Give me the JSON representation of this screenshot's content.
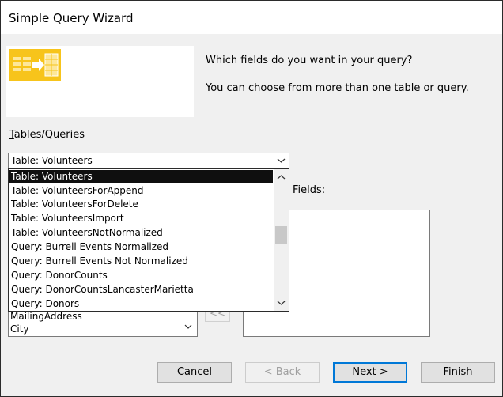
{
  "window": {
    "title": "Simple Query Wizard"
  },
  "colors": {
    "accent": "#0078d7",
    "selection": "#0f0f0f",
    "wizard_art": "#f7c41b"
  },
  "prompts": {
    "line1": "Which fields do you want in your query?",
    "line2": "You can choose from more than one table or query."
  },
  "tables_queries": {
    "label_access": "T",
    "label_rest": "ables/Queries",
    "selected": "Table: Volunteers",
    "options": [
      "Table: Volunteers",
      "Table: VolunteersForAppend",
      "Table: VolunteersForDelete",
      "Table: VolunteersImport",
      "Table: VolunteersNotNormalized",
      "Query: Burrell Events Normalized",
      "Query: Burrell Events Not Normalized",
      "Query: DonorCounts",
      "Query: DonorCountsLancasterMarietta",
      "Query: Donors"
    ]
  },
  "available_fields": {
    "items": [
      "MailingAddress",
      "City"
    ]
  },
  "selected_fields": {
    "label": "Fields:"
  },
  "move_buttons": {
    "remove_all": "<<"
  },
  "buttons": {
    "cancel": "Cancel",
    "back_access": "B",
    "back_prefix": "< ",
    "back_rest": "ack",
    "next_access": "N",
    "next_rest": "ext >",
    "finish_access": "F",
    "finish_rest": "inish"
  }
}
